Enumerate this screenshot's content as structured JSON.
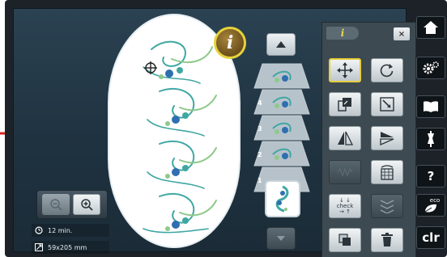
{
  "status": {
    "time_icon": "clock-icon",
    "stitch_time": "12 min.",
    "size_icon": "resize-icon",
    "design_size": "59x205 mm"
  },
  "canvas": {
    "info_label": "i",
    "hoop_color": "#ffffff",
    "motif_colors": [
      "#3fa7a3",
      "#8ec98a",
      "#2f6fb0"
    ]
  },
  "layers": {
    "items": [
      {
        "num": "4"
      },
      {
        "num": "3"
      },
      {
        "num": "2"
      },
      {
        "num": "1"
      }
    ]
  },
  "tool_panel": {
    "title": "i",
    "close_label": "×",
    "check_label_1": "check",
    "accent": "#e6cf3b"
  },
  "side_nav": {
    "help_label": "?",
    "eco_label": "eco",
    "clr_label": "clr"
  },
  "arrow_color": "#d9251c"
}
